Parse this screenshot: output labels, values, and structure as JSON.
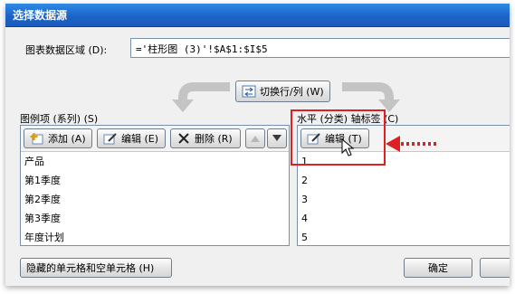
{
  "dialog": {
    "title": "选择数据源"
  },
  "range": {
    "label": "图表数据区域 (D):",
    "value": "='柱形图 (3)'!$A$1:$I$5"
  },
  "switch_button": {
    "label": "切换行/列 (W)",
    "icon": "swap-icon"
  },
  "legend": {
    "header": "图例项 (系列) (S)",
    "add_label": "添加 (A)",
    "edit_label": "编辑 (E)",
    "delete_label": "删除 (R)",
    "items": [
      "产品",
      "第1季度",
      "第2季度",
      "第3季度",
      "年度计划"
    ]
  },
  "axis": {
    "header": "水平 (分类) 轴标签 (C)",
    "edit_label": "编辑 (T)",
    "items": [
      "1",
      "2",
      "3",
      "4",
      "5"
    ]
  },
  "footer": {
    "hidden_cells_label": "隐藏的单元格和空单元格 (H)",
    "ok_label": "确定"
  },
  "colors": {
    "title_bar": "#1c64c8",
    "annotation": "#e02020"
  }
}
